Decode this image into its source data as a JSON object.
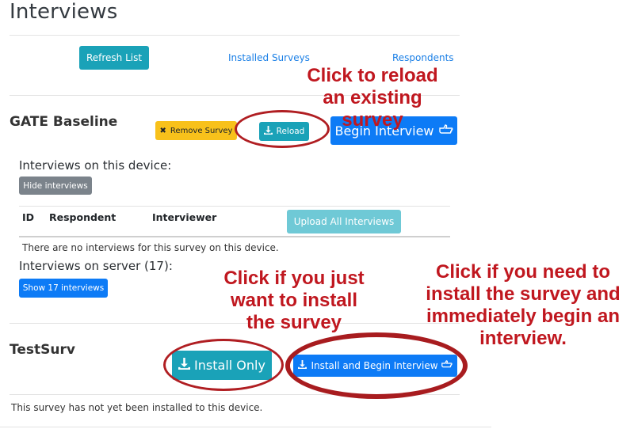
{
  "page": {
    "title": "Interviews"
  },
  "top_nav": {
    "refresh_label": "Refresh List",
    "installed_label": "Installed Surveys",
    "respondents_label": "Respondents"
  },
  "survey1": {
    "name": "GATE Baseline",
    "remove_label": "Remove Survey",
    "reload_label": "Reload",
    "begin_label": "Begin Interview",
    "interviews_device_heading": "Interviews on this device:",
    "hide_label": "Hide interviews",
    "table": {
      "columns": [
        "ID",
        "Respondent",
        "Interviewer"
      ],
      "upload_label": "Upload All Interviews",
      "empty_text": "There are no interviews for this survey on this device."
    },
    "server_heading": "Interviews on server (17):",
    "show_label": "Show 17 interviews"
  },
  "survey2": {
    "name": "TestSurv",
    "install_label": "Install Only",
    "install_begin_label": "Install and Begin Interview",
    "status_text": "This survey has not yet been installed to this device."
  },
  "annotations": {
    "reload_note": "Click to reload an existing survey",
    "install_only_note": "Click if you just want to install the survey",
    "install_begin_note": "Click if you need to install the survey and immediately begin an interview."
  },
  "icons": {
    "remove": "times-icon",
    "reload": "download-icon",
    "begin": "hand-pointer-icon",
    "install": "download-icon"
  },
  "colors": {
    "teal": "#1aa2b8",
    "blue": "#0d7bf6",
    "yellow": "#f8c11b",
    "gray": "#7b838b",
    "annotation_red": "#c0171f"
  }
}
